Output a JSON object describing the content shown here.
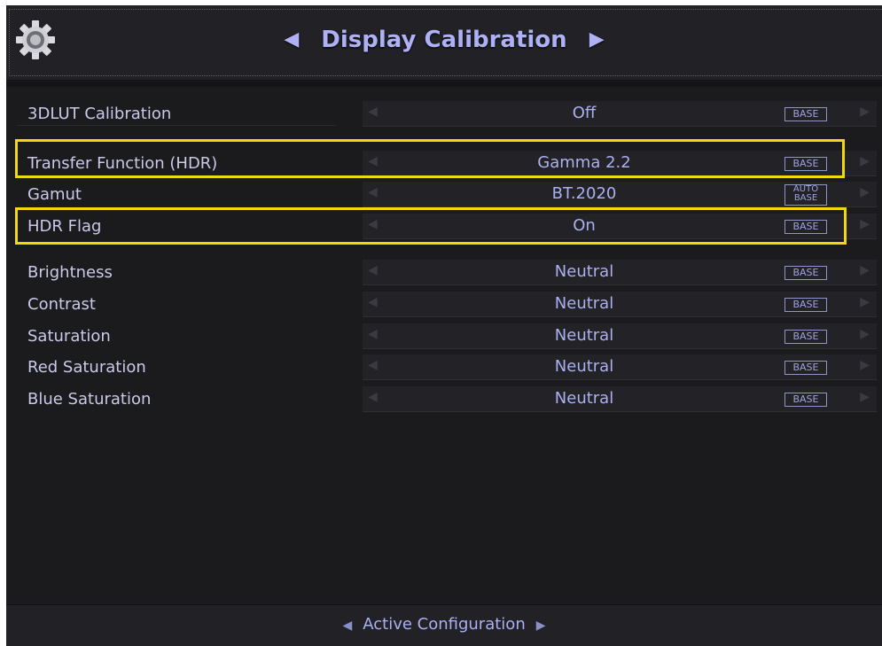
{
  "header": {
    "title": "Display Calibration",
    "left_arrow": "◀",
    "right_arrow": "▶",
    "gear_icon": "gear-icon"
  },
  "rows": [
    {
      "label": "3DLUT Calibration",
      "value": "Off",
      "badge_line1": "BASE",
      "badge_line2": ""
    },
    {
      "label": "Transfer Function (HDR)",
      "value": "Gamma 2.2",
      "badge_line1": "BASE",
      "badge_line2": ""
    },
    {
      "label": "Gamut",
      "value": "BT.2020",
      "badge_line1": "AUTO",
      "badge_line2": "BASE"
    },
    {
      "label": "HDR Flag",
      "value": "On",
      "badge_line1": "BASE",
      "badge_line2": ""
    },
    {
      "label": "Brightness",
      "value": "Neutral",
      "badge_line1": "BASE",
      "badge_line2": ""
    },
    {
      "label": "Contrast",
      "value": "Neutral",
      "badge_line1": "BASE",
      "badge_line2": ""
    },
    {
      "label": "Saturation",
      "value": "Neutral",
      "badge_line1": "BASE",
      "badge_line2": ""
    },
    {
      "label": "Red Saturation",
      "value": "Neutral",
      "badge_line1": "BASE",
      "badge_line2": ""
    },
    {
      "label": "Blue Saturation",
      "value": "Neutral",
      "badge_line1": "BASE",
      "badge_line2": ""
    }
  ],
  "row_arrows": {
    "left": "◀",
    "right": "▶"
  },
  "footer": {
    "label": "Active Configuration",
    "left_arrow": "◀",
    "right_arrow": "▶"
  },
  "colors": {
    "accent": "#aeb1f5",
    "highlight": "#f2d80e",
    "background": "#1b1b1d"
  }
}
